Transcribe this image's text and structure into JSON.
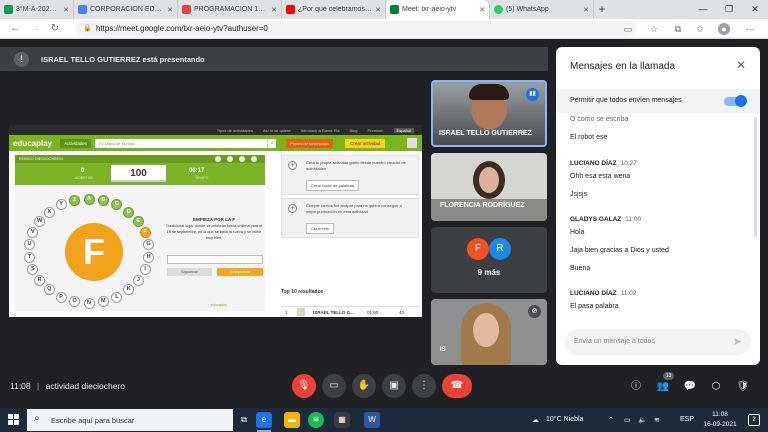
{
  "browser": {
    "tabs": [
      {
        "label": "3°M-A-2021 - Hojas de...",
        "color": "#0f9d58"
      },
      {
        "label": "CORPORACIÓN EDUCA...",
        "color": "#4285f4"
      },
      {
        "label": "PROGRAMACION 16 D...",
        "color": "#ea4335"
      },
      {
        "label": "¿Por qué celebramos el...",
        "color": "#ff0000"
      },
      {
        "label": "Meet: txr-aeio-ytv",
        "color": "#00832d"
      },
      {
        "label": "(5) WhatsApp",
        "color": "#25d366"
      }
    ],
    "url": "https://meet.google.com/txr-aeio-ytv?authuser=0"
  },
  "meet": {
    "presenter_banner": "ISRAEL TELLO GUTIERREZ está presentando",
    "meeting_time": "11:08",
    "meeting_name": "actividad dieciochero",
    "participant_count": "13"
  },
  "presentation": {
    "top_links": [
      "Tipos de actividades",
      "Así lo se quiere",
      "Introducir a Game Pla",
      "Blog",
      "Premium",
      "Español"
    ],
    "logo": "educaplay",
    "actividades": "Actividades",
    "search_placeholder": "Ej: Mapa de Europa...",
    "suscripcion": "Planes de suscripción",
    "crear": "Crear actividad",
    "game_header": "ROSCO DIECIOCHERO",
    "stat_left": "0",
    "stat_left_sub": "ACIERTOS",
    "score": "100",
    "stat_right": "06:17",
    "stat_right_sub": "TIEMPO",
    "big_letter": "F",
    "ring_letters": [
      "A",
      "B",
      "C",
      "D",
      "E",
      "F",
      "G",
      "H",
      "I",
      "J",
      "K",
      "L",
      "M",
      "N",
      "O",
      "P",
      "Q",
      "R",
      "S",
      "T",
      "U",
      "V",
      "W",
      "X",
      "Y",
      "Z"
    ],
    "clue_title": "EMPIEZA POR LA F",
    "clue_text": "Tradicional lugar donde se celebran fonda chilena para el 18 de septiembre, en la que se baila la cueca y se come muy bien.",
    "btn_next": "Siguiente",
    "btn_check": "Comprobar",
    "powered": "educaplay",
    "card1_text": "Crea tu propia actividad gratis desde nuestro creador de actividades",
    "card1_btn": "Crear rosco de palabras",
    "card2_text": "Cumple ciertos fué atrapar para no quiero conseguir a mejor puntuación en esta actividad",
    "card2_btn": "Crear reto",
    "top10_title": "Top 10 resultados",
    "top10_row": {
      "rank": "1",
      "name": "ISRAEL TELLO G...",
      "time": "01:00",
      "score": "40"
    }
  },
  "tiles": [
    {
      "name": "ISRAEL TELLO GUTIERREZ"
    },
    {
      "name": "FLORENCIA RODRÍGUEZ"
    },
    {
      "more": "9 más",
      "avatars": [
        "F",
        "R"
      ]
    },
    {
      "name": ""
    }
  ],
  "chat": {
    "title": "Mensajes en la llamada",
    "allow_label": "Permitir que todos envíen mensajes",
    "messages": [
      {
        "text": "O como se escriba"
      },
      {
        "text": "El robot ese"
      },
      {
        "sender": "LUCIANO DÍAZ",
        "time": "10:27"
      },
      {
        "text": "Ohh esa esta wena"
      },
      {
        "text": "Jsjsjs"
      },
      {
        "sender": "GLADYS GALAZ",
        "time": "11:00"
      },
      {
        "text": "Hola"
      },
      {
        "text": "Jaja bien gracias a Dios y usted"
      },
      {
        "text": "Buena"
      },
      {
        "sender": "LUCIANO DÍAZ",
        "time": "11:02"
      },
      {
        "text": "El pasa palabra"
      }
    ],
    "input_placeholder": "Envía un mensaje a todos"
  },
  "taskbar": {
    "search_placeholder": "Escribe aquí para buscar",
    "weather": "10°C  Niebla",
    "lang": "ESP",
    "time": "11:08",
    "date": "16-09-2021"
  }
}
